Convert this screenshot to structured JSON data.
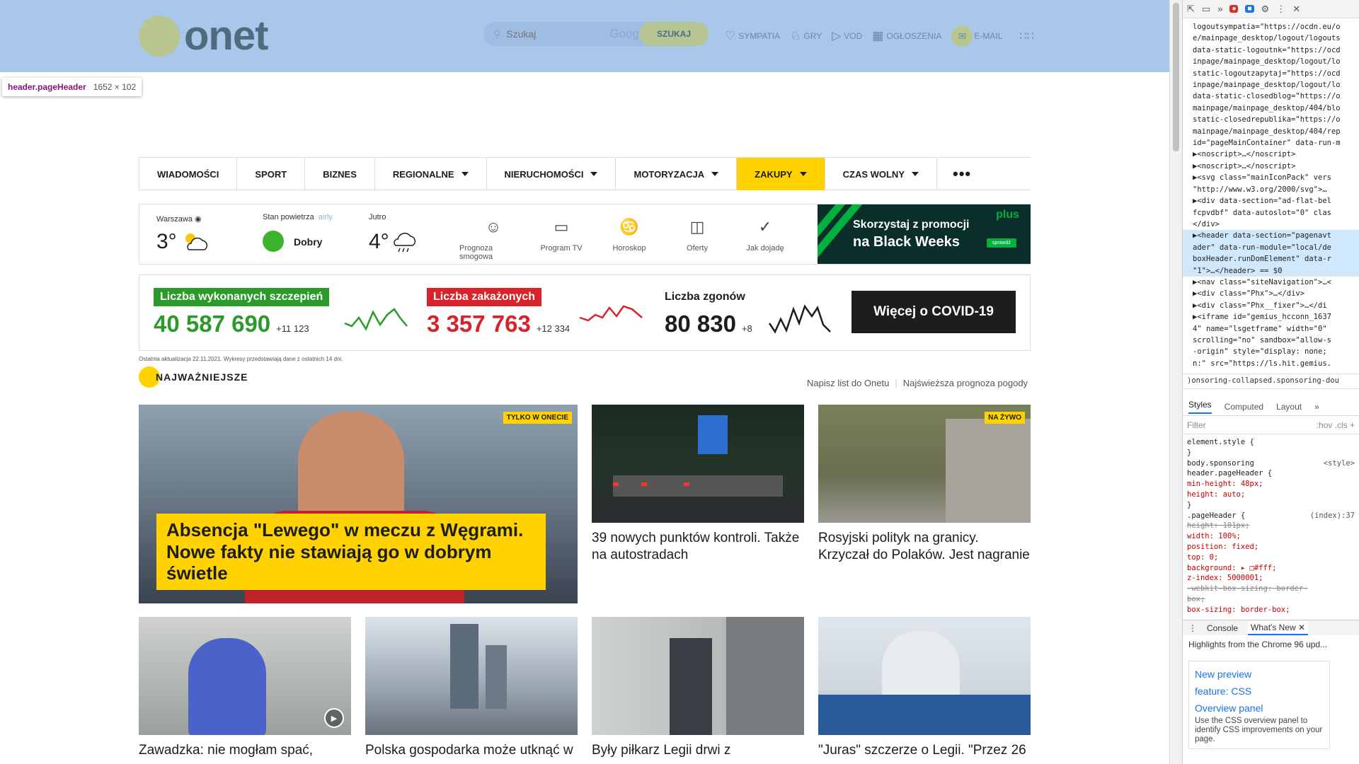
{
  "header": {
    "logo_text": "onet",
    "search_placeholder": "Szukaj",
    "google_label": "Google",
    "search_button": "SZUKAJ",
    "nav": [
      {
        "icon": "heart-icon",
        "label": "SYMPATIA"
      },
      {
        "icon": "games-icon",
        "label": "GRY"
      },
      {
        "icon": "play-icon",
        "label": "VOD"
      },
      {
        "icon": "classifieds-icon",
        "label": "OGŁOSZENIA"
      },
      {
        "icon": "mail-icon",
        "label": "E-MAIL"
      }
    ]
  },
  "tooltip": {
    "tag": "header.pageHeader",
    "size": "1652 × 102"
  },
  "main_nav": [
    {
      "label": "WIADOMOŚCI",
      "caret": false
    },
    {
      "label": "SPORT",
      "caret": false
    },
    {
      "label": "BIZNES",
      "caret": false
    },
    {
      "label": "REGIONALNE",
      "caret": true
    },
    {
      "label": "NIERUCHOMOŚCI",
      "caret": true
    },
    {
      "label": "MOTORYZACJA",
      "caret": true
    },
    {
      "label": "ZAKUPY",
      "caret": true,
      "active": true
    },
    {
      "label": "CZAS WOLNY",
      "caret": true
    }
  ],
  "more_label": "•••",
  "weather": {
    "city": "Warszawa",
    "temp": "3°",
    "air_label": "Stan powietrza",
    "airly": "airly",
    "air_status": "Dobry",
    "tomorrow_label": "Jutro",
    "tomorrow_temp": "4°",
    "links": [
      "Prognoza smogowa",
      "Program TV",
      "Horoskop",
      "Oferty",
      "Jak dojadę"
    ],
    "ad": {
      "brand": "plus",
      "line1": "Skorzystaj z promocji",
      "line2": "na Black Weeks",
      "cta": "sprawdź"
    }
  },
  "covid": {
    "vacc_label": "Liczba wykonanych szczepień",
    "vacc_value": "40 587 690",
    "vacc_delta": "+11 123",
    "inf_label": "Liczba zakażonych",
    "inf_value": "3 357 763",
    "inf_delta": "+12 334",
    "death_label": "Liczba zgonów",
    "death_value": "80 830",
    "death_delta": "+8",
    "button": "Więcej o COVID-19",
    "note": "Ostatnia aktualizacja 22.11.2021. Wykresy przedstawiają dane z ostatnich 14 dni.",
    "colors": {
      "vacc": "#2a9a2a",
      "inf": "#d8232a",
      "death": "#1d1d1b"
    }
  },
  "section": {
    "title": "NAJWAŻNIEJSZE",
    "link1": "Napisz list do Onetu",
    "link2": "Najświeższa prognoza pogody"
  },
  "articles": {
    "main": {
      "badge": "TYLKO W ONECIE",
      "title": "Absencja \"Lewego\" w meczu z Węgrami. Nowe fakty nie stawiają go w dobrym świetle"
    },
    "a2": {
      "title": "39 nowych punktów kontroli. Także na autostradach"
    },
    "a3": {
      "badge": "NA ŻYWO",
      "title": "Rosyjski polityk na granicy. Krzyczał do Polaków. Jest nagranie"
    },
    "a4": {
      "title": "Zawadzka: nie mogłam spać,"
    },
    "a5": {
      "title": "Polska gospodarka może utknąć w"
    },
    "a6": {
      "title": "Były piłkarz Legii drwi z"
    },
    "a7": {
      "title": "\"Juras\" szczerze o Legii. \"Przez 26"
    }
  },
  "devtools": {
    "dom_lines": [
      "logoutsympatia=\"https://ocdn.eu/o",
      "e/mainpage_desktop/logout/logouts",
      "data-static-logoutnk=\"https://ocd",
      "inpage/mainpage_desktop/logout/lo",
      "static-logoutzapytaj=\"https://ocd",
      "inpage/mainpage_desktop/logout/lo",
      "data-static-closedblog=\"https://o",
      "mainpage/mainpage_desktop/404/blo",
      "static-closedrepublika=\"https://o",
      "mainpage/mainpage_desktop/404/rep",
      "id=\"pageMainContainer\" data-run-m",
      "  ▶<noscript>…</noscript>",
      "  ▶<noscript>…</noscript>",
      "  ▶<svg class=\"mainIconPack\" vers",
      "   \"http://www.w3.org/2000/svg\">…",
      "  ▶<div data-section=\"ad-flat-bel",
      "   fcpvdbf\" data-autoslot=\"0\" clas",
      "   </div>",
      "  ▶<header data-section=\"pagenavt",
      "   ader\" data-run-module=\"local/de",
      "   boxHeader.runDomElement\" data-r",
      "   \"1\">…</header> == $0",
      "  ▶<nav class=\"siteNavigation\">…<",
      "  ▶<div class=\"Phx\">…</div>",
      "  ▶<div class=\"Phx__fixer\">…</di",
      "  ▶<iframe id=\"gemius_hcconn_1637",
      "   4\" name=\"lsgetframe\" width=\"0\"",
      "   scrolling=\"no\" sandbox=\"allow-s",
      "   -origin\" style=\"display: none; ",
      "   n:\" src=\"https://ls.hit.gemius."
    ],
    "breadcrumb": ")onsoring-collapsed.sponsoring-dou",
    "tabs": [
      "Styles",
      "Computed",
      "Layout",
      "»"
    ],
    "filter_placeholder": "Filter",
    "filter_tools": ":hov .cls",
    "styles_lines": [
      {
        "t": "element.style {",
        "c": ""
      },
      {
        "t": "}",
        "c": ""
      },
      {
        "t": "body.sponsoring",
        "c": "",
        "src": "<style>"
      },
      {
        "t": "header.pageHeader {",
        "c": ""
      },
      {
        "t": "  min-height: 48px;",
        "c": "p"
      },
      {
        "t": "  height: auto;",
        "c": "p"
      },
      {
        "t": "}",
        "c": ""
      },
      {
        "t": ".pageHeader {",
        "c": "",
        "src": "(index):37"
      },
      {
        "t": "  height: 101px;",
        "c": "st"
      },
      {
        "t": "  width: 100%;",
        "c": "p"
      },
      {
        "t": "  position: fixed;",
        "c": "p"
      },
      {
        "t": "  top: 0;",
        "c": "p"
      },
      {
        "t": "  background: ▸ □#fff;",
        "c": "p"
      },
      {
        "t": "  z-index: 5000001;",
        "c": "p"
      },
      {
        "t": "  -webkit-box-sizing: border-",
        "c": "st"
      },
      {
        "t": "    box;",
        "c": "st"
      },
      {
        "t": "  box-sizing: border-box;",
        "c": "p"
      }
    ],
    "console_tabs": [
      "Console",
      "What's New"
    ],
    "news_headline": "Highlights from the Chrome 96 upd...",
    "news_link1": "New preview",
    "news_link2": "feature: CSS",
    "news_link3": "Overview panel",
    "news_desc": "Use the CSS overview panel to identify CSS improvements on your page."
  }
}
